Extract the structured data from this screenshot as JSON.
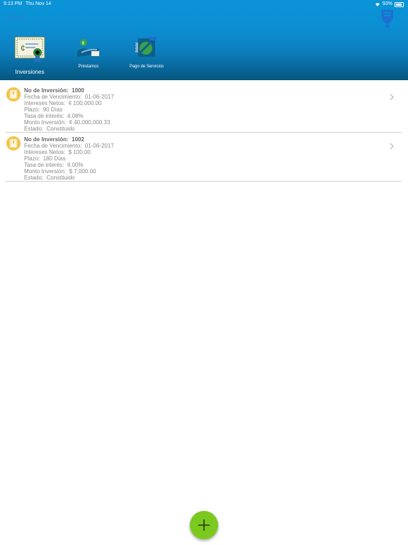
{
  "status_bar": {
    "time": "9:13 PM",
    "date": "Thu Nov 14",
    "battery": "93%"
  },
  "header": {
    "menu_label": "Menu"
  },
  "tabs": [
    {
      "label": "Inversiones",
      "icon": "certificate-icon",
      "selected": true
    },
    {
      "label": "Préstamos",
      "icon": "loan-hand-coin-icon",
      "selected": false
    },
    {
      "label": "Pago de Servicios",
      "icon": "bill-payment-icon",
      "selected": false
    }
  ],
  "investments": [
    {
      "numero_label": "No de Inversión:",
      "numero": "1000",
      "vencimiento_label": "Fecha de Vencimiento:",
      "vencimiento": "01-06-2017",
      "intereses_label": "Intereses Netos:",
      "intereses": "¢ 100,000.00",
      "plazo_label": "Plazo:",
      "plazo": "90  Días",
      "tasa_label": "Tasa de interés:",
      "tasa": "4.08%",
      "monto_label": "Monto Inversión:",
      "monto": "¢ 40,000,000.33",
      "estado_label": "Estado:",
      "estado": "Constituido"
    },
    {
      "numero_label": "No de Inversión:",
      "numero": "1002",
      "vencimiento_label": "Fecha de Vencimiento:",
      "vencimiento": "01-06-2017",
      "intereses_label": "Intereses Netos:",
      "intereses": "$ 100.00",
      "plazo_label": "Plazo:",
      "plazo": "180  Días",
      "tasa_label": "Tasa de interés:",
      "tasa": "6.00%",
      "monto_label": "Monto Inversión:",
      "monto": "$ 7,000.00",
      "estado_label": "Estado:",
      "estado": "Constituido"
    }
  ],
  "colors": {
    "header": "#0a93d6",
    "accent_fab": "#7bc81e",
    "badge": "#f5c242",
    "menu_link": "#2a7ee0"
  },
  "fab": {
    "icon": "plus-icon"
  }
}
